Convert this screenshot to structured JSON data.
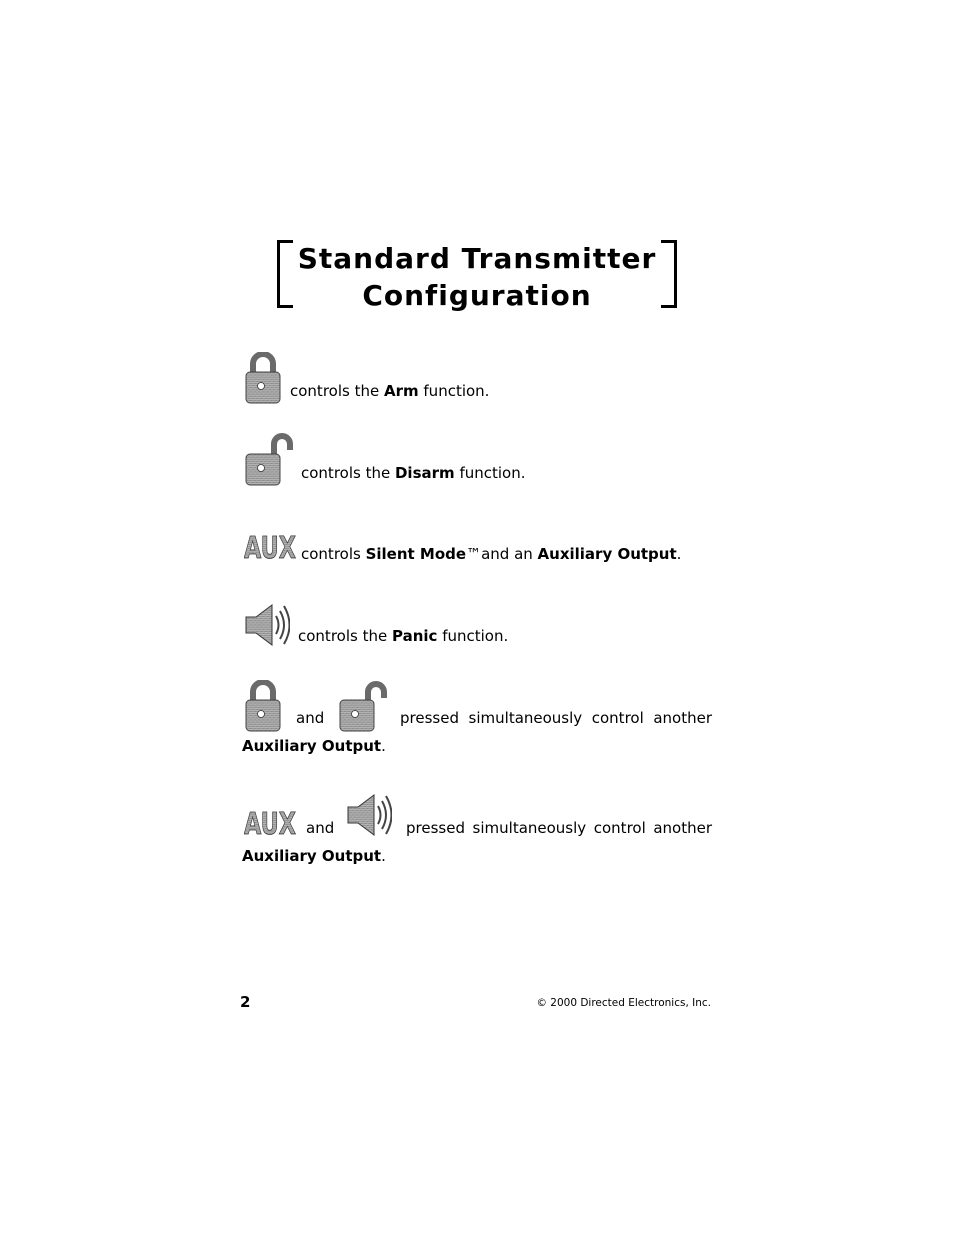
{
  "title": {
    "line1": "Standard Transmitter",
    "line2": "Configuration"
  },
  "items": [
    {
      "icons": [
        "lock-closed-icon"
      ],
      "pre": "controls the",
      "bold": "Arm",
      "post": "function."
    },
    {
      "icons": [
        "lock-open-icon"
      ],
      "pre": "controls the",
      "bold": "Disarm",
      "post": "function."
    },
    {
      "icons": [
        "aux-icon"
      ],
      "pre": "controls",
      "bold": "Silent Mode",
      "tm": "™",
      "mid": "and an",
      "bold2": "Auxiliary Output",
      "post": "."
    },
    {
      "icons": [
        "speaker-icon"
      ],
      "pre": "controls the",
      "bold": "Panic",
      "post": "function."
    },
    {
      "icons": [
        "lock-closed-icon",
        "lock-open-icon"
      ],
      "and": "and",
      "words": [
        "pressed",
        "simultaneously",
        "control",
        "another"
      ],
      "bold": "Auxiliary Output",
      "post": "."
    },
    {
      "icons": [
        "aux-icon",
        "speaker-icon"
      ],
      "and": "and",
      "words": [
        "pressed",
        "simultaneously",
        "control",
        "another"
      ],
      "bold": "Auxiliary Output",
      "post": "."
    }
  ],
  "footer": {
    "page_number": "2",
    "copyright": "© 2000 Directed Electronics, Inc."
  }
}
